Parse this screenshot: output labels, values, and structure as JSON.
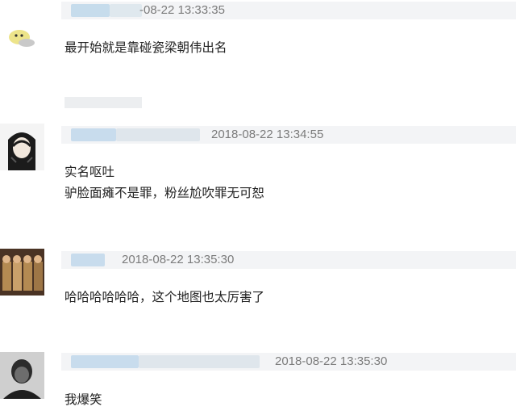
{
  "comments": [
    {
      "timestamp": "-08-22 13:33:35",
      "lines": [
        "最开始就是靠碰瓷梁朝伟出名"
      ]
    },
    {
      "timestamp": "2018-08-22 13:34:55",
      "lines": [
        "实名呕吐",
        "驴脸面瘫不是罪，粉丝尬吹罪无可恕"
      ]
    },
    {
      "timestamp": "2018-08-22 13:35:30",
      "lines": [
        "哈哈哈哈哈哈，这个地图也太厉害了"
      ]
    },
    {
      "timestamp": "2018-08-22 13:35:30",
      "lines": [
        "我爆笑"
      ]
    }
  ]
}
